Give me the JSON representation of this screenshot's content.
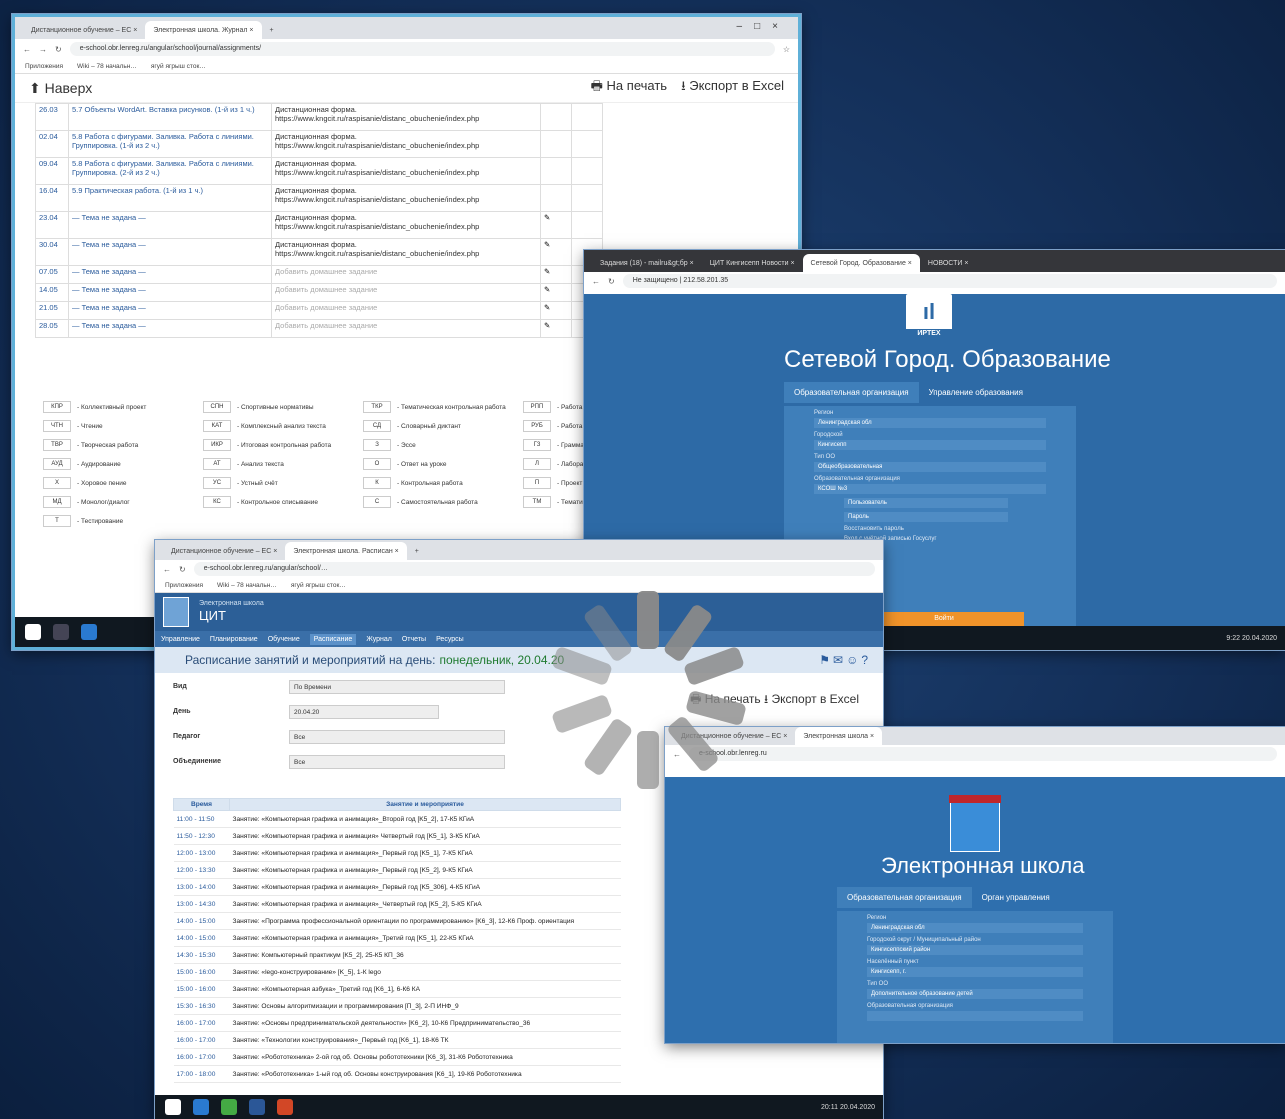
{
  "colors": {
    "accent": "#2d6aa6",
    "spinner": "#8a8a8a",
    "orange": "#f0932a"
  },
  "w1": {
    "tabs": [
      "Дистанционное обучение – ЕС ×",
      "Электронная школа. Журнал ×"
    ],
    "url": "e-school.obr.lenreg.ru/angular/school/journal/assignments/",
    "bookmarks": [
      "Приложения",
      "Wiki – 78 начальн…",
      "ягуй ягрыш сток…"
    ],
    "nav_label": "Наверх",
    "print_label": "На печать",
    "export_label": "Экспорт в Excel",
    "rows": [
      {
        "date": "26.03",
        "topic": "5.7 Объекты WordArt. Вставка рисунков. (1-й из 1 ч.)",
        "hw": "Дистанционная форма. https://www.kngcit.ru/raspisanie/distanc_obuchenie/index.php"
      },
      {
        "date": "02.04",
        "topic": "5.8 Работа с фигурами. Заливка. Работа с линиями. Группировка. (1-й из 2 ч.)",
        "hw": "Дистанционная форма. https://www.kngcit.ru/raspisanie/distanc_obuchenie/index.php"
      },
      {
        "date": "09.04",
        "topic": "5.8 Работа с фигурами. Заливка. Работа с линиями. Группировка. (2-й из 2 ч.)",
        "hw": "Дистанционная форма. https://www.kngcit.ru/raspisanie/distanc_obuchenie/index.php"
      },
      {
        "date": "16.04",
        "topic": "5.9 Практическая работа. (1-й из 1 ч.)",
        "hw": "Дистанционная форма. https://www.kngcit.ru/raspisanie/distanc_obuchenie/index.php"
      },
      {
        "date": "23.04",
        "topic": "— Тема не задана —",
        "hw": "Дистанционная форма. https://www.kngcit.ru/raspisanie/distanc_obuchenie/index.php"
      },
      {
        "date": "30.04",
        "topic": "— Тема не задана —",
        "hw": "Дистанционная форма. https://www.kngcit.ru/raspisanie/distanc_obuchenie/index.php"
      },
      {
        "date": "07.05",
        "topic": "— Тема не задана —",
        "hw": "Добавить домашнее задание"
      },
      {
        "date": "14.05",
        "topic": "— Тема не задана —",
        "hw": "Добавить домашнее задание"
      },
      {
        "date": "21.05",
        "topic": "— Тема не задана —",
        "hw": "Добавить домашнее задание"
      },
      {
        "date": "28.05",
        "topic": "— Тема не задана —",
        "hw": "Добавить домашнее задание"
      }
    ],
    "legend": [
      {
        "code": "КПР",
        "label": "- Коллективный проект"
      },
      {
        "code": "СПН",
        "label": "- Спортивные нормативы"
      },
      {
        "code": "ТКР",
        "label": "- Тематическая контрольная работа"
      },
      {
        "code": "РПП",
        "label": "- Работа на уроке"
      },
      {
        "code": "ЧТН",
        "label": "- Чтение"
      },
      {
        "code": "КАТ",
        "label": "- Комплексный анализ текста"
      },
      {
        "code": "СД",
        "label": "- Словарный диктант"
      },
      {
        "code": "РУБ",
        "label": "- Работа на уроке"
      },
      {
        "code": "ТВР",
        "label": "- Творческая работа"
      },
      {
        "code": "ИКР",
        "label": "- Итоговая контрольная работа"
      },
      {
        "code": "З",
        "label": "- Эссе"
      },
      {
        "code": "ГЗ",
        "label": "- Грамматическое"
      },
      {
        "code": "АУД",
        "label": "- Аудирование"
      },
      {
        "code": "АТ",
        "label": "- Анализ текста"
      },
      {
        "code": "О",
        "label": "- Ответ на уроке"
      },
      {
        "code": "Л",
        "label": "- Лабораторная работа"
      },
      {
        "code": "Х",
        "label": "- Хоровое пение"
      },
      {
        "code": "УС",
        "label": "- Устный счёт"
      },
      {
        "code": "К",
        "label": "- Контрольная работа"
      },
      {
        "code": "П",
        "label": "- Проект"
      },
      {
        "code": "МД",
        "label": "- Монолог/диалог"
      },
      {
        "code": "КС",
        "label": "- Контрольное списывание"
      },
      {
        "code": "С",
        "label": "- Самостоятельная работа"
      },
      {
        "code": "ТМ",
        "label": "- Тематическая работа"
      },
      {
        "code": "Т",
        "label": "- Тестирование"
      }
    ]
  },
  "w2": {
    "tabs": [
      "Задания (18) - mailru&gt;бр ×",
      "ЦИТ Кингисепп Новости ×",
      "Сетевой Город. Образование ×",
      "НОВОСТИ ×"
    ],
    "url": "Не защищено | 212.58.201.35",
    "logo_caption": "ИРТЕХ",
    "title": "Сетевой Город. Образование",
    "tab_org": "Образовательная организация",
    "tab_mgmt": "Управление образования",
    "fields": [
      {
        "label": "Регион",
        "value": "Ленинградская обл"
      },
      {
        "label": "Городской",
        "value": "Кингисепп"
      },
      {
        "label": "Тип ОО",
        "value": "Общеобразовательная"
      },
      {
        "label": "Образовательная организация",
        "value": "КСОШ №3"
      }
    ],
    "login_ph": "Пользователь",
    "pass_ph": "Пароль",
    "forgot": "Восстановить пароль",
    "gosuslugi": "Вход с учётной записью Госуслуг",
    "login_btn": "Войти",
    "clock": "9:22 20.04.2020"
  },
  "w3": {
    "tabs": [
      "Дистанционное обучение – ЕС ×",
      "Электронная школа. Расписан ×"
    ],
    "url": "e-school.obr.lenreg.ru/angular/school/…",
    "bookmarks": [
      "Приложения",
      "Wiki – 78 начальн…",
      "ягуй ягрыш сток…"
    ],
    "site_sub": "Электронная школа",
    "site_title": "ЦИТ",
    "menu": [
      "Управление",
      "Планирование",
      "Обучение",
      "Расписание",
      "Журнал",
      "Отчеты",
      "Ресурсы"
    ],
    "page_title": "Расписание занятий и мероприятий на день:",
    "page_date": "понедельник, 20.04.20",
    "print_label": "На печать",
    "export_label": "Экспорт в Excel",
    "form": [
      {
        "label": "Вид",
        "value": "По Времени"
      },
      {
        "label": "День",
        "value": "20.04.20"
      },
      {
        "label": "Педагог",
        "value": "Все"
      },
      {
        "label": "Объединение",
        "value": "Все"
      }
    ],
    "col_time": "Время",
    "col_event": "Занятие и мероприятие",
    "schedule": [
      {
        "t": "11:00 - 11:50",
        "e": "Занятие: «Компьютерная графика и анимация»_Второй год [K5_2], 17-К5 КГиА"
      },
      {
        "t": "11:50 - 12:30",
        "e": "Занятие: «Компьютерная графика и анимация» Четвертый год [K5_1], 3-К5 КГиА"
      },
      {
        "t": "12:00 - 13:00",
        "e": "Занятие: «Компьютерная графика и анимация»_Первый год [K5_1], 7-К5 КГиА"
      },
      {
        "t": "12:00 - 13:30",
        "e": "Занятие: «Компьютерная графика и анимация»_Первый год [K5_2], 9-К5 КГиА"
      },
      {
        "t": "13:00 - 14:00",
        "e": "Занятие: «Компьютерная графика и анимация»_Первый год [K5_306], 4-К5 КГиА"
      },
      {
        "t": "13:00 - 14:30",
        "e": "Занятие: «Компьютерная графика и анимация»_Четвертый год [K5_2], 5-К5 КГиА"
      },
      {
        "t": "14:00 - 15:00",
        "e": "Занятие: «Программа профессиональной ориентации по программированию» [K6_3], 12-К6 Проф. ориентация"
      },
      {
        "t": "14:00 - 15:00",
        "e": "Занятие: «Компьютерная графика и анимация»_Третий год [K5_1], 22-К5 КГиА"
      },
      {
        "t": "14:30 - 15:30",
        "e": "Занятие: Компьютерный практикум [K5_2], 25-К5 КП_36"
      },
      {
        "t": "15:00 - 16:00",
        "e": "Занятие: «lego-конструирование» [K_5], 1-К lego"
      },
      {
        "t": "15:00 - 16:00",
        "e": "Занятие: «Компьютерная азбука»_Третий год [K6_1], 6-К6 КА"
      },
      {
        "t": "15:30 - 16:30",
        "e": "Занятие: Основы алгоритмизации и программирования [П_3], 2-П ИНФ_9"
      },
      {
        "t": "16:00 - 17:00",
        "e": "Занятие: «Основы предпринимательской деятельности» [K6_2], 10-К6 Предпринимательство_36"
      },
      {
        "t": "16:00 - 17:00",
        "e": "Занятие: «Технологии конструирования»_Первый год [K6_1], 18-К6 ТК"
      },
      {
        "t": "16:00 - 17:00",
        "e": "Занятие: «Робототехника» 2-ой год об. Основы робототехники [K6_3], 31-К6 Робототехника"
      },
      {
        "t": "17:00 - 18:00",
        "e": "Занятие: «Робототехника» 1-ый год об. Основы конструирования [K6_1], 19-К6 Робототехника"
      }
    ],
    "clock": "20:11 20.04.2020"
  },
  "w4": {
    "tabs": [
      "Дистанционное обучение – ЕС ×",
      "Электронная школа ×"
    ],
    "url": "e-school.obr.lenreg.ru",
    "title": "Электронная школа",
    "tab_org": "Образовательная организация",
    "tab_mgmt": "Орган управления",
    "fields": [
      {
        "label": "Регион",
        "value": "Ленинградская обл"
      },
      {
        "label": "Городской округ / Муниципальный район",
        "value": "Кингисеппский район"
      },
      {
        "label": "Населённый пункт",
        "value": "Кингисепп, г."
      },
      {
        "label": "Тип ОО",
        "value": "Дополнительное образование детей"
      },
      {
        "label": "Образовательная организация",
        "value": ""
      }
    ]
  }
}
